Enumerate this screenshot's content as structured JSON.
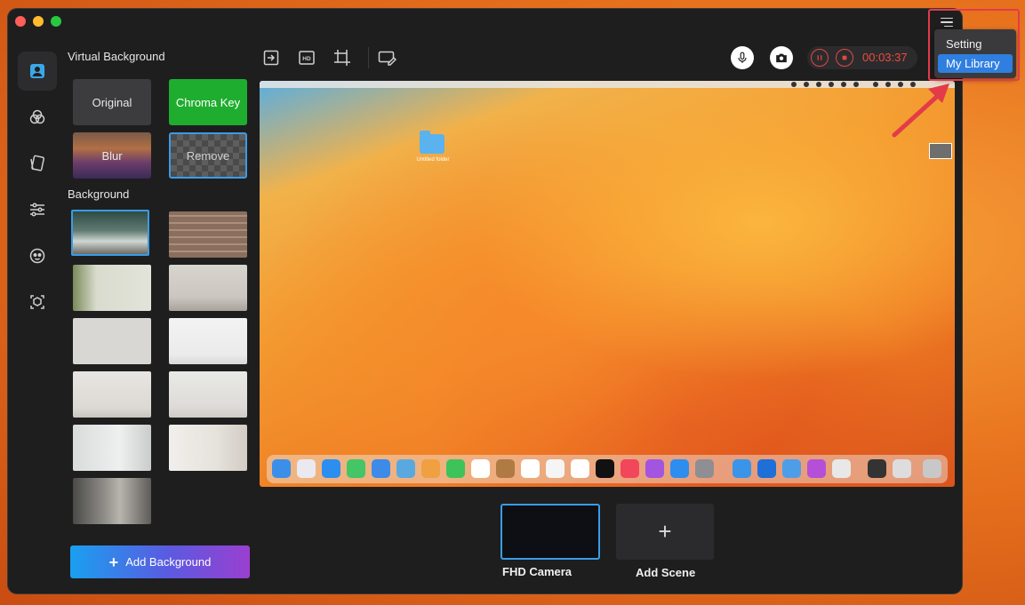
{
  "window": {
    "traffic_lights": [
      "close",
      "minimize",
      "zoom"
    ]
  },
  "rail": {
    "items": [
      {
        "icon": "person-portrait-icon",
        "active": true
      },
      {
        "icon": "color-filter-icon",
        "active": false
      },
      {
        "icon": "sticker-icon",
        "active": false
      },
      {
        "icon": "sliders-icon",
        "active": false
      },
      {
        "icon": "avatar-face-icon",
        "active": false
      },
      {
        "icon": "3d-box-icon",
        "active": false
      }
    ]
  },
  "panel": {
    "virtual_background_title": "Virtual Background",
    "buttons": {
      "original": "Original",
      "chroma_key": "Chroma Key",
      "blur": "Blur",
      "remove": "Remove"
    },
    "background_title": "Background",
    "add_background_label": "Add Background"
  },
  "toolbar": {
    "icons": [
      "enter-icon",
      "hd-icon",
      "crop-icon",
      "screen-annotate-icon",
      "microphone-icon",
      "camera-icon",
      "pause-icon",
      "stop-icon"
    ],
    "recording_time": "00:03:37"
  },
  "preview": {
    "folder_label": "Untitled folder"
  },
  "scenes": {
    "camera_label": "FHD Camera",
    "add_label": "Add Scene",
    "add_symbol": "+"
  },
  "menu": {
    "setting": "Setting",
    "my_library": "My Library"
  },
  "colors": {
    "accent_blue": "#3a9ce6",
    "chroma_green": "#1fad2f",
    "record_red": "#ef4a3c",
    "menu_highlight": "#2f7fe0",
    "annotation_red": "#e33b48"
  }
}
